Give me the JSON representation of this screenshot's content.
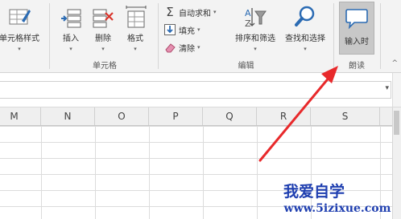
{
  "ribbon": {
    "cell_style": {
      "label": "单元格样式"
    },
    "cells_group": {
      "label": "单元格",
      "insert": "插入",
      "delete": "删除",
      "format": "格式"
    },
    "edit_group": {
      "label": "编辑",
      "autosum": "自动求和",
      "fill": "填充",
      "clear": "清除",
      "sort_filter": "排序和筛选",
      "find_select": "查找和选择"
    },
    "read_group": {
      "label": "朗读",
      "speak_on_enter": "输入时"
    }
  },
  "grid": {
    "columns": [
      "M",
      "N",
      "O",
      "P",
      "Q",
      "R",
      "S"
    ]
  },
  "watermark": {
    "line1": "我爱自学",
    "line2": "www.5izixue.com"
  },
  "colors": {
    "arrow": "#e8292b",
    "watermark": "#1f3fb0",
    "delete_mark": "#d9352c",
    "accent_blue": "#2b6bb3"
  }
}
